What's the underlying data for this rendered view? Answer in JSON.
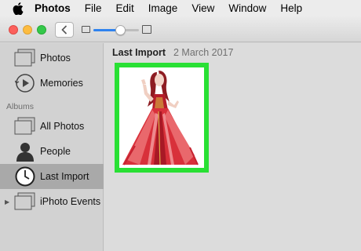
{
  "menubar": {
    "app_name": "Photos",
    "items": [
      "File",
      "Edit",
      "Image",
      "View",
      "Window",
      "Help"
    ]
  },
  "toolbar": {
    "zoom_level": 0.6
  },
  "sidebar": {
    "library_items": [
      {
        "label": "Photos",
        "icon": "photos-icon"
      },
      {
        "label": "Memories",
        "icon": "memories-icon"
      }
    ],
    "albums_header": "Albums",
    "album_items": [
      {
        "label": "All Photos",
        "icon": "folder-icon"
      },
      {
        "label": "People",
        "icon": "person-icon"
      },
      {
        "label": "Last Import",
        "icon": "clock-icon",
        "selected": true
      },
      {
        "label": "iPhoto Events",
        "icon": "folder-icon"
      }
    ]
  },
  "content": {
    "title": "Last Import",
    "date": "2 March 2017"
  },
  "colors": {
    "selection_highlight": "#29e034",
    "slider_accent": "#2f83ef",
    "sidebar_selected": "#a9a9a9"
  }
}
